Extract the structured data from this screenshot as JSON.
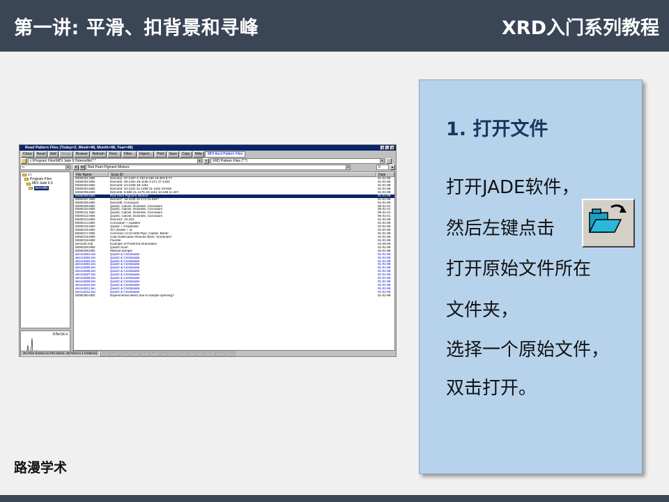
{
  "header": {
    "title": "第一讲: 平滑、扣背景和寻峰",
    "series": "XRD入门系列教程"
  },
  "footer": {
    "brand": "路漫学术"
  },
  "window": {
    "title": "Read Pattern Files (Today=2, Week=48, Month=48, Year=48)",
    "toolbar": [
      "Close",
      "Read",
      "Add",
      "Merge",
      "Browse",
      "Refresh",
      "Find...",
      "Filter...",
      "Import...",
      "Print",
      "Save",
      "Copy",
      "Help"
    ],
    "format_label": "MDI Ascii Pattern Files",
    "path": "c:\\Program Files\\MDI Jade 6.0\\demofile\\*.*",
    "filter": "XRD Pattern Files (*.*)",
    "drive": "c:",
    "tree": [
      "c:\\",
      "Program Files",
      "MDI Jade 6.0",
      "demofile"
    ],
    "selected_name": "Red Paint Pigment Mixture",
    "page_num": "0",
    "columns": [
      "File Name",
      "Scan ID",
      "Date"
    ],
    "rows": [
      {
        "name": "DEMO01.MDI",
        "scan": "Demo01: 37-1497 4-733 9-169 18-303 9-77",
        "date": "01-01-99",
        "style": ""
      },
      {
        "name": "DEMO02.MDI",
        "scan": "Demo02: 36-1451 25-1135 4-471 27-1402",
        "date": "01-01-99",
        "style": ""
      },
      {
        "name": "DEMO03.MDI",
        "scan": "Demo03: 24-1035 36-1451",
        "date": "01-01-99",
        "style": ""
      },
      {
        "name": "DEMO04.MDI",
        "scan": "Demo04: 33-1161 41-1486 21-1152 19-629",
        "date": "01-01-99",
        "style": ""
      },
      {
        "name": "DEMO05.MDI",
        "scan": "Demo05: 5-586 41-1475 33-1161 34-189 11-46?",
        "date": "01-01-99",
        "style": ""
      },
      {
        "name": "DEMO06.MDI",
        "scan": "Red Paint Pigment Mixture",
        "date": "01-01-99",
        "style": "selected"
      },
      {
        "name": "DEMO07.MDI",
        "scan": "Demo07: 19-1130 10-173 31-564?",
        "date": "01-01-99",
        "style": ""
      },
      {
        "name": "DEMO08.MDI",
        "scan": "Demo08: Corundum",
        "date": "01-01-99",
        "style": ""
      },
      {
        "name": "DEMO09.MDI",
        "scan": "Quartz, Calcite, Dolomite, Corundum",
        "date": "05-31-01",
        "style": ""
      },
      {
        "name": "DEMO10.MDI",
        "scan": "Quartz, Calcite, Dolomite, Corundum",
        "date": "05-31-01",
        "style": ""
      },
      {
        "name": "DEMO11.MDI",
        "scan": "Quartz, Calcite, Dolomite, Corundum",
        "date": "05-31-01",
        "style": ""
      },
      {
        "name": "DEMO12.MDI",
        "scan": "Quartz, Calcite, Dolomite, Corundum",
        "date": "05-31-01",
        "style": ""
      },
      {
        "name": "DEMO13.MDI",
        "scan": "Demo13: 10-423",
        "date": "01-01-99",
        "style": ""
      },
      {
        "name": "DEMO14.MDI",
        "scan": "Corundum + Apatites",
        "date": "01-01-99",
        "style": ""
      },
      {
        "name": "DEMO15.MDI",
        "scan": "Quartz + Celadonite",
        "date": "01-01-99",
        "style": ""
      },
      {
        "name": "DEMO16.MDI",
        "scan": "X/Y Zeolite + Si",
        "date": "01-01-99",
        "style": ""
      },
      {
        "name": "DEMO17.MDI",
        "scan": "Corrosion of Oil Well Pipe: Calcite, Barite",
        "date": "01-01-99",
        "style": ""
      },
      {
        "name": "DEMO18.MDI",
        "scan": "Coal Gasification Reactor Brick \"unreacted\"",
        "date": "01-01-99",
        "style": ""
      },
      {
        "name": "DEMO19.MDI",
        "scan": "Fluorite",
        "date": "01-01-99",
        "style": ""
      },
      {
        "name": "demo20.mdi",
        "scan": "Example of Preferred Orientation",
        "date": "04-26-99",
        "style": ""
      },
      {
        "name": "DEMO28.MDI",
        "scan": "Quartz Scan",
        "date": "01-01-99",
        "style": ""
      },
      {
        "name": "DEMO29.MDI",
        "scan": "Mineral Sample",
        "date": "01-01-99",
        "style": ""
      },
      {
        "name": "demo3d01.bin",
        "scan": "Quartz & Cristobalite",
        "date": "01-01-99",
        "style": "blue"
      },
      {
        "name": "demo3d02.bin",
        "scan": "Quartz & Cristobalite",
        "date": "01-01-99",
        "style": "blue"
      },
      {
        "name": "demo3d03.bin",
        "scan": "Quartz & Cristobalite",
        "date": "01-01-99",
        "style": "blue"
      },
      {
        "name": "demo3d04.bin",
        "scan": "Quartz & Cristobalite",
        "date": "01-01-99",
        "style": "blue"
      },
      {
        "name": "demo3d05.bin",
        "scan": "Quartz & Cristobalite",
        "date": "01-01-99",
        "style": "blue"
      },
      {
        "name": "demo3d06.bin",
        "scan": "Quartz & Cristobalite",
        "date": "01-01-99",
        "style": "blue"
      },
      {
        "name": "demo3d07.bin",
        "scan": "Quartz & Cristobalite",
        "date": "01-01-99",
        "style": "blue"
      },
      {
        "name": "demo3d08.bin",
        "scan": "Quartz & Cristobalite",
        "date": "01-01-99",
        "style": "blue"
      },
      {
        "name": "demo3d09.bin",
        "scan": "Quartz & Cristobalite",
        "date": "01-01-99",
        "style": "blue"
      },
      {
        "name": "demo3d10.bin",
        "scan": "Quartz & Cristobalite",
        "date": "01-01-99",
        "style": "blue"
      },
      {
        "name": "demo3d11.bin",
        "scan": "Quartz & Cristobalite",
        "date": "01-01-99",
        "style": "blue"
      },
      {
        "name": "demo3d12.bin",
        "scan": "Quartz & Cristobalite",
        "date": "01-01-99",
        "style": "blue"
      },
      {
        "name": "DEMO50.MDI",
        "scan": "Experimental defect due to sample spinning?",
        "date": "01-01-99",
        "style": ""
      }
    ],
    "preview_label": "P/N=34.4",
    "status_main": "35 Files Sorted on File Name, 36 Files in 1 Folder(s)",
    "status_tags": [
      "SAV",
      "PKS",
      "DSP",
      "PDX",
      "RFT",
      "RPT",
      "PID",
      "SZS",
      "XID",
      "FIT",
      "2TH",
      "ABC",
      "RRF",
      "ZOM"
    ]
  },
  "panel": {
    "step": "1. 打开文件",
    "lines": [
      "打开JADE软件，",
      "然后左键点击",
      "打开原始文件所在",
      "文件夹，",
      "选择一个原始文件，",
      "双击打开。"
    ]
  },
  "colors": {
    "header_bg": "#3a4556",
    "panel_bg": "#b7d3ec",
    "step_color": "#17375e",
    "win_title_bg": "#0a246a"
  }
}
